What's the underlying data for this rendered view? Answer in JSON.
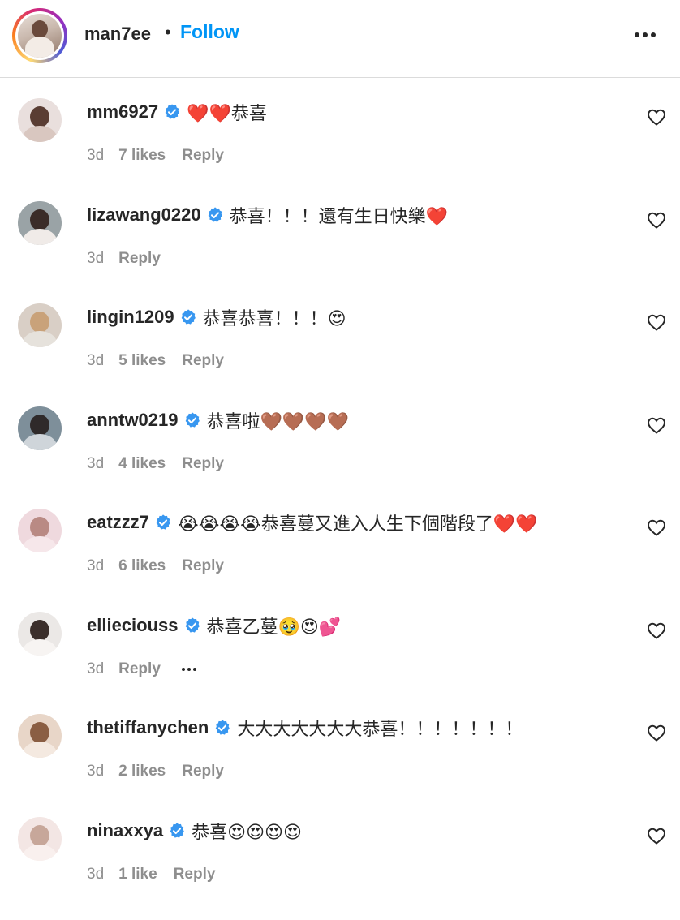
{
  "header": {
    "username": "man7ee",
    "separator": "•",
    "follow_label": "Follow",
    "more_icon": "more-horizontal-icon"
  },
  "colors": {
    "link_blue": "#0095f6",
    "text": "#262626",
    "secondary_text": "#8e8e8e",
    "verified_blue": "#3897f0",
    "divider": "#dbdbdb"
  },
  "comments": [
    {
      "username": "mm6927",
      "verified": true,
      "text": "❤️❤️恭喜",
      "time": "3d",
      "likes": "7 likes",
      "reply_label": "Reply",
      "avatar_colors": [
        "#e9dfdd",
        "#5a3d33",
        "#d9c7c0"
      ]
    },
    {
      "username": "lizawang0220",
      "verified": true,
      "text": "恭喜！！！還有生日快樂❤️",
      "time": "3d",
      "likes": "",
      "reply_label": "Reply",
      "avatar_colors": [
        "#9aa3a6",
        "#3a2c28",
        "#f0ebe8"
      ]
    },
    {
      "username": "lingin1209",
      "verified": true,
      "text": "恭喜恭喜！！！😍",
      "time": "3d",
      "likes": "5 likes",
      "reply_label": "Reply",
      "avatar_colors": [
        "#d9cfc6",
        "#c9a27a",
        "#e6e2dc"
      ]
    },
    {
      "username": "anntw0219",
      "verified": true,
      "text": "恭喜啦🤎🤎🤎🤎",
      "time": "3d",
      "likes": "4 likes",
      "reply_label": "Reply",
      "avatar_colors": [
        "#7e8f9a",
        "#2f2a2a",
        "#cfd5da"
      ]
    },
    {
      "username": "eatzzz7",
      "verified": true,
      "text": "😭😭😭😭恭喜蔓又進入人生下個階段了❤️❤️",
      "time": "3d",
      "likes": "6 likes",
      "reply_label": "Reply",
      "avatar_colors": [
        "#efd9de",
        "#b98a84",
        "#f6e7ea"
      ]
    },
    {
      "username": "ellieciouss",
      "verified": true,
      "text": "恭喜乙蔓🥹😍💕",
      "time": "3d",
      "likes": "",
      "reply_label": "Reply",
      "show_options": true,
      "avatar_colors": [
        "#ebe8e6",
        "#3b2f2b",
        "#f7f4f2"
      ]
    },
    {
      "username": "thetiffanychen",
      "verified": true,
      "text": "大大大大大大大恭喜！！！！！！！",
      "time": "3d",
      "likes": "2 likes",
      "reply_label": "Reply",
      "avatar_colors": [
        "#e8d6c8",
        "#8a5e43",
        "#f4e9e0"
      ]
    },
    {
      "username": "ninaxxya",
      "verified": true,
      "text": "恭喜😍😍😍😍",
      "time": "3d",
      "likes": "1 like",
      "reply_label": "Reply",
      "avatar_colors": [
        "#f3e6e4",
        "#c7a79a",
        "#f9f0ee"
      ]
    }
  ]
}
